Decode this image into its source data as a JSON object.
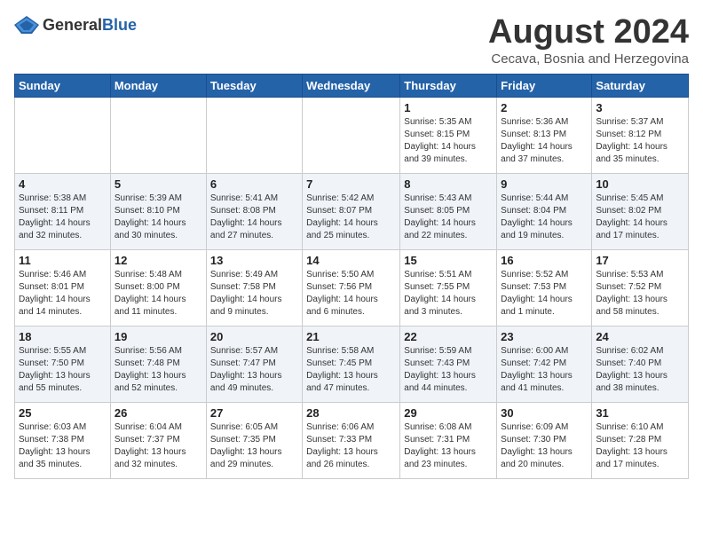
{
  "header": {
    "logo_general": "General",
    "logo_blue": "Blue",
    "month_title": "August 2024",
    "subtitle": "Cecava, Bosnia and Herzegovina"
  },
  "weekdays": [
    "Sunday",
    "Monday",
    "Tuesday",
    "Wednesday",
    "Thursday",
    "Friday",
    "Saturday"
  ],
  "weeks": [
    [
      {
        "day": "",
        "info": ""
      },
      {
        "day": "",
        "info": ""
      },
      {
        "day": "",
        "info": ""
      },
      {
        "day": "",
        "info": ""
      },
      {
        "day": "1",
        "info": "Sunrise: 5:35 AM\nSunset: 8:15 PM\nDaylight: 14 hours\nand 39 minutes."
      },
      {
        "day": "2",
        "info": "Sunrise: 5:36 AM\nSunset: 8:13 PM\nDaylight: 14 hours\nand 37 minutes."
      },
      {
        "day": "3",
        "info": "Sunrise: 5:37 AM\nSunset: 8:12 PM\nDaylight: 14 hours\nand 35 minutes."
      }
    ],
    [
      {
        "day": "4",
        "info": "Sunrise: 5:38 AM\nSunset: 8:11 PM\nDaylight: 14 hours\nand 32 minutes."
      },
      {
        "day": "5",
        "info": "Sunrise: 5:39 AM\nSunset: 8:10 PM\nDaylight: 14 hours\nand 30 minutes."
      },
      {
        "day": "6",
        "info": "Sunrise: 5:41 AM\nSunset: 8:08 PM\nDaylight: 14 hours\nand 27 minutes."
      },
      {
        "day": "7",
        "info": "Sunrise: 5:42 AM\nSunset: 8:07 PM\nDaylight: 14 hours\nand 25 minutes."
      },
      {
        "day": "8",
        "info": "Sunrise: 5:43 AM\nSunset: 8:05 PM\nDaylight: 14 hours\nand 22 minutes."
      },
      {
        "day": "9",
        "info": "Sunrise: 5:44 AM\nSunset: 8:04 PM\nDaylight: 14 hours\nand 19 minutes."
      },
      {
        "day": "10",
        "info": "Sunrise: 5:45 AM\nSunset: 8:02 PM\nDaylight: 14 hours\nand 17 minutes."
      }
    ],
    [
      {
        "day": "11",
        "info": "Sunrise: 5:46 AM\nSunset: 8:01 PM\nDaylight: 14 hours\nand 14 minutes."
      },
      {
        "day": "12",
        "info": "Sunrise: 5:48 AM\nSunset: 8:00 PM\nDaylight: 14 hours\nand 11 minutes."
      },
      {
        "day": "13",
        "info": "Sunrise: 5:49 AM\nSunset: 7:58 PM\nDaylight: 14 hours\nand 9 minutes."
      },
      {
        "day": "14",
        "info": "Sunrise: 5:50 AM\nSunset: 7:56 PM\nDaylight: 14 hours\nand 6 minutes."
      },
      {
        "day": "15",
        "info": "Sunrise: 5:51 AM\nSunset: 7:55 PM\nDaylight: 14 hours\nand 3 minutes."
      },
      {
        "day": "16",
        "info": "Sunrise: 5:52 AM\nSunset: 7:53 PM\nDaylight: 14 hours\nand 1 minute."
      },
      {
        "day": "17",
        "info": "Sunrise: 5:53 AM\nSunset: 7:52 PM\nDaylight: 13 hours\nand 58 minutes."
      }
    ],
    [
      {
        "day": "18",
        "info": "Sunrise: 5:55 AM\nSunset: 7:50 PM\nDaylight: 13 hours\nand 55 minutes."
      },
      {
        "day": "19",
        "info": "Sunrise: 5:56 AM\nSunset: 7:48 PM\nDaylight: 13 hours\nand 52 minutes."
      },
      {
        "day": "20",
        "info": "Sunrise: 5:57 AM\nSunset: 7:47 PM\nDaylight: 13 hours\nand 49 minutes."
      },
      {
        "day": "21",
        "info": "Sunrise: 5:58 AM\nSunset: 7:45 PM\nDaylight: 13 hours\nand 47 minutes."
      },
      {
        "day": "22",
        "info": "Sunrise: 5:59 AM\nSunset: 7:43 PM\nDaylight: 13 hours\nand 44 minutes."
      },
      {
        "day": "23",
        "info": "Sunrise: 6:00 AM\nSunset: 7:42 PM\nDaylight: 13 hours\nand 41 minutes."
      },
      {
        "day": "24",
        "info": "Sunrise: 6:02 AM\nSunset: 7:40 PM\nDaylight: 13 hours\nand 38 minutes."
      }
    ],
    [
      {
        "day": "25",
        "info": "Sunrise: 6:03 AM\nSunset: 7:38 PM\nDaylight: 13 hours\nand 35 minutes."
      },
      {
        "day": "26",
        "info": "Sunrise: 6:04 AM\nSunset: 7:37 PM\nDaylight: 13 hours\nand 32 minutes."
      },
      {
        "day": "27",
        "info": "Sunrise: 6:05 AM\nSunset: 7:35 PM\nDaylight: 13 hours\nand 29 minutes."
      },
      {
        "day": "28",
        "info": "Sunrise: 6:06 AM\nSunset: 7:33 PM\nDaylight: 13 hours\nand 26 minutes."
      },
      {
        "day": "29",
        "info": "Sunrise: 6:08 AM\nSunset: 7:31 PM\nDaylight: 13 hours\nand 23 minutes."
      },
      {
        "day": "30",
        "info": "Sunrise: 6:09 AM\nSunset: 7:30 PM\nDaylight: 13 hours\nand 20 minutes."
      },
      {
        "day": "31",
        "info": "Sunrise: 6:10 AM\nSunset: 7:28 PM\nDaylight: 13 hours\nand 17 minutes."
      }
    ]
  ]
}
